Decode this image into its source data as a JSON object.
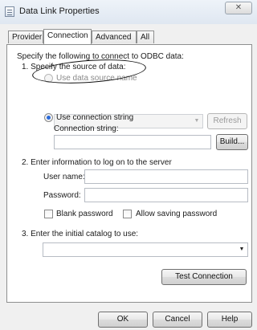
{
  "window": {
    "title": "Data Link Properties",
    "close_label": "✕"
  },
  "tabs": [
    "Provider",
    "Connection",
    "Advanced",
    "All"
  ],
  "connection": {
    "intro": "Specify the following to connect to ODBC data:",
    "step1": "1. Specify the source of data:",
    "opt_dsn": "Use data source name",
    "refresh": "Refresh",
    "opt_connstr": "Use connection string",
    "connstr_label": "Connection string:",
    "connstr_value": "",
    "build": "Build...",
    "step2": "2. Enter information to log on to the server",
    "username_label": "User name:",
    "username_value": "",
    "password_label": "Password:",
    "password_value": "",
    "blank_password": "Blank password",
    "allow_saving": "Allow saving password",
    "step3": "3. Enter the initial catalog to use:",
    "catalog_value": "",
    "test": "Test Connection"
  },
  "footer": {
    "ok": "OK",
    "cancel": "Cancel",
    "help": "Help"
  }
}
